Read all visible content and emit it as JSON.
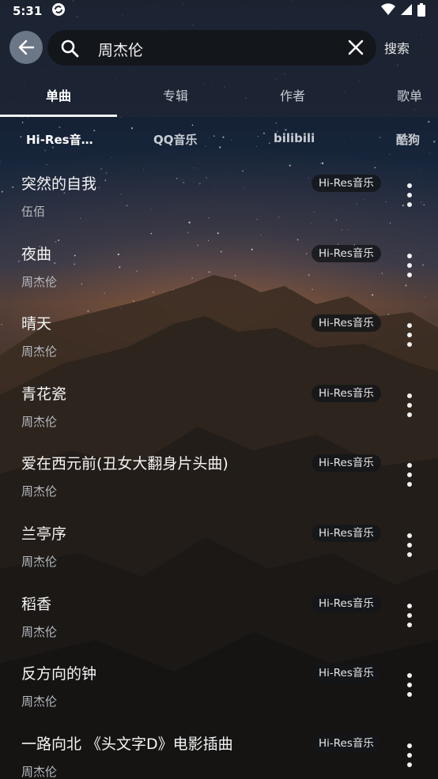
{
  "status_bar": {
    "time": "5:31"
  },
  "search": {
    "query": "周杰伦",
    "submit_label": "搜索"
  },
  "tabs": [
    {
      "label": "单曲",
      "active": true
    },
    {
      "label": "专辑",
      "active": false
    },
    {
      "label": "作者",
      "active": false
    },
    {
      "label": "歌单",
      "active": false
    }
  ],
  "sources": [
    {
      "label": "Hi-Res音…",
      "active": true
    },
    {
      "label": "QQ音乐",
      "active": false
    },
    {
      "label": "bilibili",
      "active": false
    },
    {
      "label": "酷狗",
      "active": false
    }
  ],
  "songs": [
    {
      "title": "突然的自我",
      "artist": "伍佰",
      "source": "Hi-Res音乐"
    },
    {
      "title": "夜曲",
      "artist": "周杰伦",
      "source": "Hi-Res音乐"
    },
    {
      "title": "晴天",
      "artist": "周杰伦",
      "source": "Hi-Res音乐"
    },
    {
      "title": "青花瓷",
      "artist": "周杰伦",
      "source": "Hi-Res音乐"
    },
    {
      "title": "爱在西元前(丑女大翻身片头曲)",
      "artist": "周杰伦",
      "source": "Hi-Res音乐"
    },
    {
      "title": "兰亭序",
      "artist": "周杰伦",
      "source": "Hi-Res音乐"
    },
    {
      "title": "稻香",
      "artist": "周杰伦",
      "source": "Hi-Res音乐"
    },
    {
      "title": "反方向的钟",
      "artist": "周杰伦",
      "source": "Hi-Res音乐"
    },
    {
      "title": "一路向北 《头文字D》电影插曲",
      "artist": "周杰伦",
      "source": "Hi-Res音乐"
    }
  ],
  "icons": {
    "back": "arrow-left-icon",
    "search": "search-icon",
    "clear": "close-icon",
    "more": "more-vertical-icon",
    "wifi": "wifi-icon",
    "signal": "signal-icon",
    "battery": "battery-icon",
    "sync": "sync-status-icon"
  },
  "colors": {
    "bar_background": "#1e2634",
    "search_background": "#13161b",
    "back_button": "#6b7686"
  }
}
